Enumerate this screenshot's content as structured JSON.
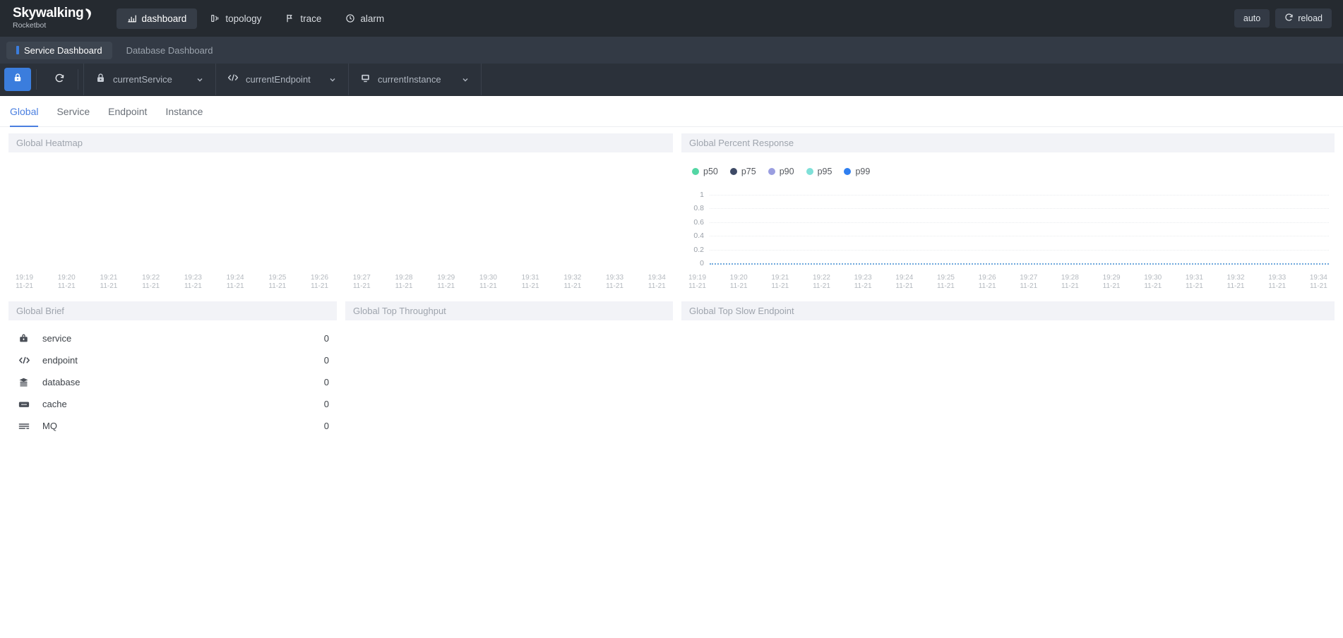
{
  "app": {
    "brand_main": "Skywalking",
    "brand_sub": "Rocketbot"
  },
  "topnav": {
    "items": [
      {
        "label": "dashboard",
        "icon": "chart-bar-icon",
        "active": true
      },
      {
        "label": "topology",
        "icon": "topology-icon",
        "active": false
      },
      {
        "label": "trace",
        "icon": "flag-icon",
        "active": false
      },
      {
        "label": "alarm",
        "icon": "clock-alert-icon",
        "active": false
      }
    ],
    "auto_label": "auto",
    "reload_label": "reload",
    "reload_icon": "refresh-icon"
  },
  "dashbar": {
    "service_dashboard": "Service Dashboard",
    "database_dashboard": "Database Dashboard"
  },
  "selectbar": {
    "lock_icon": "lock-icon",
    "refresh_icon": "refresh-icon",
    "groups": [
      {
        "label": "currentService",
        "icon": "lock-icon"
      },
      {
        "label": "currentEndpoint",
        "icon": "code-icon"
      },
      {
        "label": "currentInstance",
        "icon": "monitor-icon"
      }
    ]
  },
  "tabs": [
    {
      "label": "Global",
      "active": true
    },
    {
      "label": "Service",
      "active": false
    },
    {
      "label": "Endpoint",
      "active": false
    },
    {
      "label": "Instance",
      "active": false
    }
  ],
  "panels": {
    "heatmap_title": "Global Heatmap",
    "percent_title": "Global Percent Response",
    "brief_title": "Global Brief",
    "throughput_title": "Global Top Throughput",
    "slow_title": "Global Top Slow Endpoint"
  },
  "brief": {
    "rows": [
      {
        "icon": "service-icon",
        "name": "service",
        "value": "0"
      },
      {
        "icon": "endpoint-code-icon",
        "name": "endpoint",
        "value": "0"
      },
      {
        "icon": "database-icon",
        "name": "database",
        "value": "0"
      },
      {
        "icon": "cache-icon",
        "name": "cache",
        "value": "0"
      },
      {
        "icon": "mq-icon",
        "name": "MQ",
        "value": "0"
      }
    ]
  },
  "colors": {
    "accent": "#3b7ddd",
    "tab_active": "#4a7fe0",
    "topnav_bg": "#252a30",
    "dashbar_bg": "#333a45",
    "selbar_bg": "#2b313a",
    "panel_head_bg": "#f2f3f7",
    "zero_series": "#6fa8dc"
  },
  "chart_data": [
    {
      "type": "heatmap",
      "title": "Global Heatmap",
      "xlabel": "",
      "ylabel": "",
      "grid": false,
      "legend_position": "none",
      "categories": [
        "19:19\n11-21",
        "19:20\n11-21",
        "19:21\n11-21",
        "19:22\n11-21",
        "19:23\n11-21",
        "19:24\n11-21",
        "19:25\n11-21",
        "19:26\n11-21",
        "19:27\n11-21",
        "19:28\n11-21",
        "19:29\n11-21",
        "19:30\n11-21",
        "19:31\n11-21",
        "19:32\n11-21",
        "19:33\n11-21",
        "19:34\n11-21"
      ],
      "values": [],
      "note": "empty - no heatmap cells rendered"
    },
    {
      "type": "line",
      "title": "Global Percent Response",
      "xlabel": "",
      "ylabel": "",
      "ylim": [
        0,
        1
      ],
      "yticks": [
        "0",
        "0.2",
        "0.4",
        "0.6",
        "0.8",
        "1"
      ],
      "grid": true,
      "legend_position": "top-left",
      "categories": [
        "19:19\n11-21",
        "19:20\n11-21",
        "19:21\n11-21",
        "19:22\n11-21",
        "19:23\n11-21",
        "19:24\n11-21",
        "19:25\n11-21",
        "19:26\n11-21",
        "19:27\n11-21",
        "19:28\n11-21",
        "19:29\n11-21",
        "19:30\n11-21",
        "19:31\n11-21",
        "19:32\n11-21",
        "19:33\n11-21",
        "19:34\n11-21"
      ],
      "series": [
        {
          "name": "p50",
          "color": "#53d6a4",
          "values": [
            0,
            0,
            0,
            0,
            0,
            0,
            0,
            0,
            0,
            0,
            0,
            0,
            0,
            0,
            0,
            0
          ]
        },
        {
          "name": "p75",
          "color": "#3e4a66",
          "values": [
            0,
            0,
            0,
            0,
            0,
            0,
            0,
            0,
            0,
            0,
            0,
            0,
            0,
            0,
            0,
            0
          ]
        },
        {
          "name": "p90",
          "color": "#9a9ee0",
          "values": [
            0,
            0,
            0,
            0,
            0,
            0,
            0,
            0,
            0,
            0,
            0,
            0,
            0,
            0,
            0,
            0
          ]
        },
        {
          "name": "p95",
          "color": "#7fe0d8",
          "values": [
            0,
            0,
            0,
            0,
            0,
            0,
            0,
            0,
            0,
            0,
            0,
            0,
            0,
            0,
            0,
            0
          ]
        },
        {
          "name": "p99",
          "color": "#2f7ff0",
          "values": [
            0,
            0,
            0,
            0,
            0,
            0,
            0,
            0,
            0,
            0,
            0,
            0,
            0,
            0,
            0,
            0
          ]
        }
      ]
    }
  ],
  "xticks": [
    {
      "time": "19:19",
      "date": "11-21"
    },
    {
      "time": "19:20",
      "date": "11-21"
    },
    {
      "time": "19:21",
      "date": "11-21"
    },
    {
      "time": "19:22",
      "date": "11-21"
    },
    {
      "time": "19:23",
      "date": "11-21"
    },
    {
      "time": "19:24",
      "date": "11-21"
    },
    {
      "time": "19:25",
      "date": "11-21"
    },
    {
      "time": "19:26",
      "date": "11-21"
    },
    {
      "time": "19:27",
      "date": "11-21"
    },
    {
      "time": "19:28",
      "date": "11-21"
    },
    {
      "time": "19:29",
      "date": "11-21"
    },
    {
      "time": "19:30",
      "date": "11-21"
    },
    {
      "time": "19:31",
      "date": "11-21"
    },
    {
      "time": "19:32",
      "date": "11-21"
    },
    {
      "time": "19:33",
      "date": "11-21"
    },
    {
      "time": "19:34",
      "date": "11-21"
    }
  ],
  "yticks": [
    "1",
    "0.8",
    "0.6",
    "0.4",
    "0.2",
    "0"
  ]
}
